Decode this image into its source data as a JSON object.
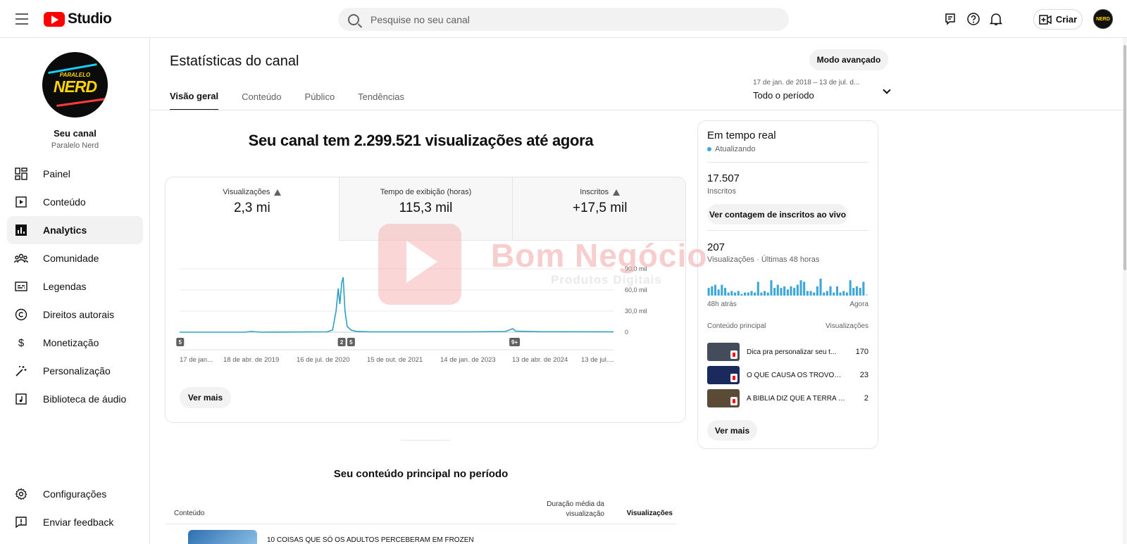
{
  "topbar": {
    "logo_text": "Studio",
    "search_placeholder": "Pesquise no seu canal",
    "create_label": "Criar",
    "avatar_text": "NERD"
  },
  "sidebar": {
    "channel_title": "Seu canal",
    "channel_name": "Paralelo Nerd",
    "avatar_line1": "PARALELO",
    "avatar_line2": "NERD",
    "items": [
      {
        "label": "Painel",
        "icon": "dashboard-icon"
      },
      {
        "label": "Conteúdo",
        "icon": "content-icon"
      },
      {
        "label": "Analytics",
        "icon": "analytics-icon",
        "active": true
      },
      {
        "label": "Comunidade",
        "icon": "community-icon"
      },
      {
        "label": "Legendas",
        "icon": "subtitles-icon"
      },
      {
        "label": "Direitos autorais",
        "icon": "copyright-icon"
      },
      {
        "label": "Monetização",
        "icon": "monetization-icon"
      },
      {
        "label": "Personalização",
        "icon": "customization-icon"
      },
      {
        "label": "Biblioteca de áudio",
        "icon": "audio-library-icon"
      }
    ],
    "bottom_items": [
      {
        "label": "Configurações",
        "icon": "settings-icon"
      },
      {
        "label": "Enviar feedback",
        "icon": "feedback-icon"
      }
    ]
  },
  "main": {
    "page_title": "Estatísticas do canal",
    "advanced_mode": "Modo avançado",
    "tabs": [
      "Visão geral",
      "Conteúdo",
      "Público",
      "Tendências"
    ],
    "period_range": "17 de jan. de 2018 – 13 de jul. d...",
    "period_label": "Todo o período",
    "headline": "Seu canal tem 2.299.521 visualizações até agora",
    "metrics": [
      {
        "label": "Visualizações",
        "value": "2,3 mi",
        "warning": true
      },
      {
        "label": "Tempo de exibição (horas)",
        "value": "115,3 mil",
        "warning": false
      },
      {
        "label": "Inscritos",
        "value": "+17,5 mil",
        "warning": true
      }
    ],
    "see_more": "Ver mais",
    "top_content_title": "Seu conteúdo principal no período",
    "table_headers": {
      "content": "Conteúdo",
      "avg_duration": "Duração média da visualização",
      "views": "Visualizações"
    },
    "first_row_title": "10 COISAS QUE SÓ OS ADULTOS PERCEBERAM EM FROZEN"
  },
  "chart_data": {
    "type": "line",
    "yticks": [
      "90,0 mil",
      "60,0 mil",
      "30,0 mil",
      "0"
    ],
    "ylim": [
      0,
      90000
    ],
    "xticks": [
      "17 de jan...",
      "18 de abr. de 2019",
      "16 de jul. de 2020",
      "15 de out. de 2021",
      "14 de jan. de 2023",
      "13 de abr. de 2024",
      "13 de jul...."
    ],
    "markers": [
      {
        "label": "5",
        "x": "2018-01-20"
      },
      {
        "label": "2",
        "x": "2020-06-20"
      },
      {
        "label": "5",
        "x": "2020-08-10"
      },
      {
        "label": "9+",
        "x": "2023-01-20"
      }
    ],
    "series": [
      {
        "color": "#2ba0c5",
        "points": [
          [
            "2018-01-17",
            0
          ],
          [
            "2019-01-10",
            0
          ],
          [
            "2019-02-10",
            1000
          ],
          [
            "2019-03-10",
            500
          ],
          [
            "2019-04-10",
            0
          ],
          [
            "2020-04-01",
            500
          ],
          [
            "2020-05-01",
            3000
          ],
          [
            "2020-05-20",
            30000
          ],
          [
            "2020-06-01",
            62000
          ],
          [
            "2020-06-10",
            40000
          ],
          [
            "2020-06-20",
            70000
          ],
          [
            "2020-06-28",
            78000
          ],
          [
            "2020-07-08",
            30000
          ],
          [
            "2020-07-20",
            8000
          ],
          [
            "2020-08-10",
            3000
          ],
          [
            "2020-09-10",
            1000
          ],
          [
            "2020-12-01",
            500
          ],
          [
            "2022-06-01",
            500
          ],
          [
            "2022-12-01",
            1000
          ],
          [
            "2023-01-10",
            5000
          ],
          [
            "2023-01-25",
            1500
          ],
          [
            "2023-06-01",
            700
          ],
          [
            "2024-07-13",
            500
          ]
        ]
      }
    ]
  },
  "realtime": {
    "title": "Em tempo real",
    "status": "Atualizando",
    "subs_value": "17.507",
    "subs_label": "Inscritos",
    "subs_button": "Ver contagem de inscritos ao vivo",
    "views_value": "207",
    "views_label": "Visualizações · Últimas 48 horas",
    "axis_left": "48h atrás",
    "axis_right": "Agora",
    "bar_color": "#3ea6d8",
    "bars": [
      5,
      6,
      7,
      4,
      7,
      5,
      2,
      3,
      2,
      3,
      1,
      2,
      2,
      3,
      2,
      9,
      2,
      3,
      2,
      10,
      5,
      7,
      5,
      6,
      4,
      6,
      5,
      7,
      10,
      9,
      3,
      3,
      2,
      6,
      11,
      2,
      3,
      6,
      2,
      6,
      2,
      3,
      2,
      10,
      5,
      6,
      5,
      9,
      1
    ],
    "top_content_label": "Conteúdo principal",
    "views_col_label": "Visualizações",
    "rows": [
      {
        "title": "Dica pra personalizar seu t...",
        "views": "170",
        "thumb_color": "#444b5a"
      },
      {
        "title": "O QUE CAUSA OS TROVÕES ...",
        "views": "23",
        "thumb_color": "#1b2a5c"
      },
      {
        "title": "A BÍBLIA DIZ QUE A TERRA É ...",
        "views": "2",
        "thumb_color": "#5a4a36"
      }
    ],
    "see_more": "Ver mais"
  },
  "watermark": {
    "line1": "Bom Negócio",
    "line2": "Produtos Digitais"
  }
}
